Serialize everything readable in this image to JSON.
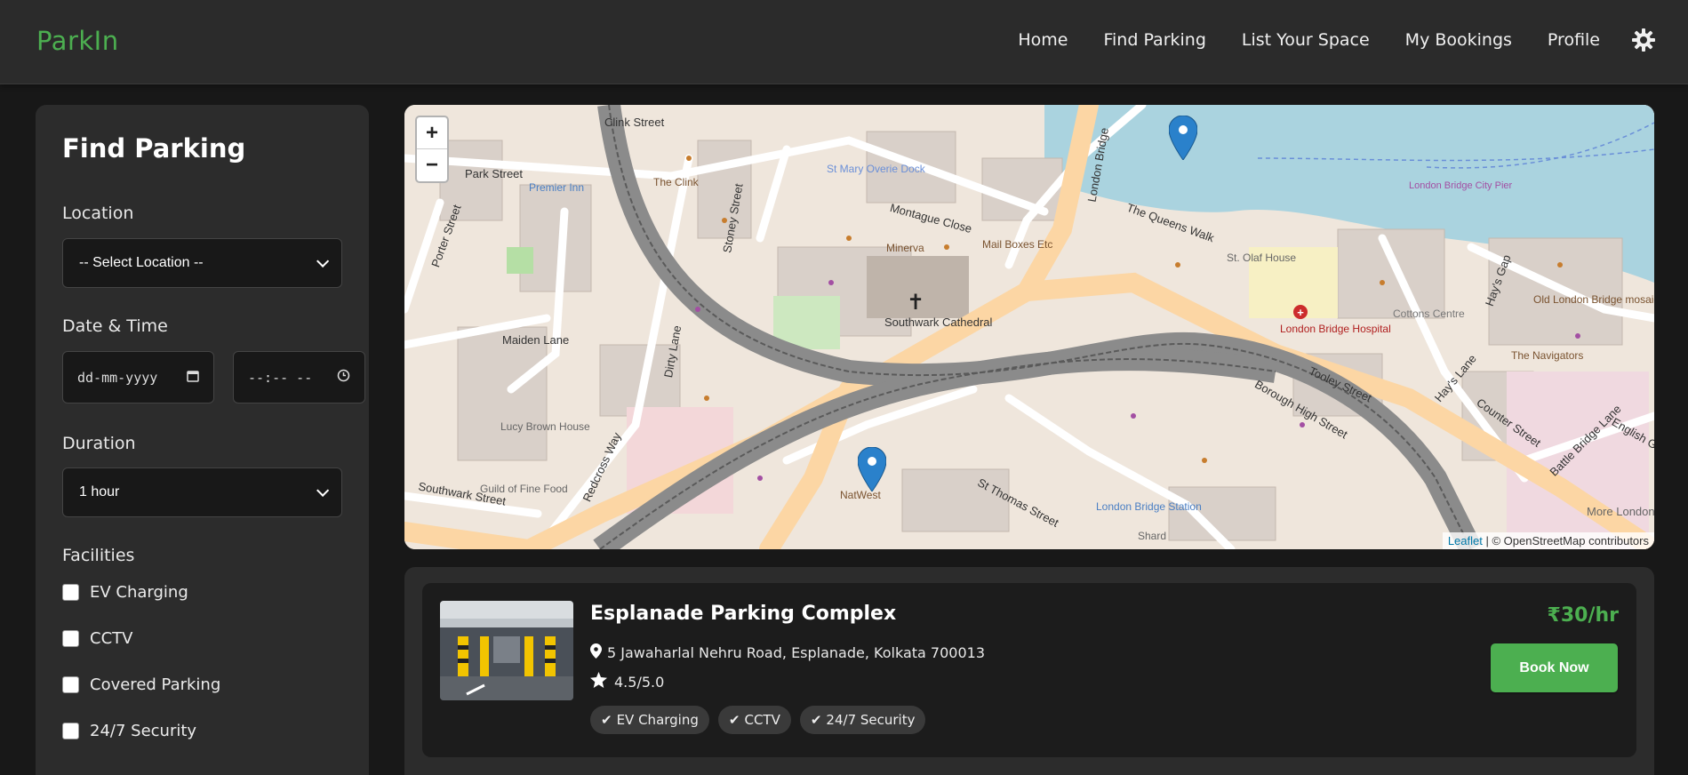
{
  "header": {
    "brand": "ParkIn",
    "nav": [
      "Home",
      "Find Parking",
      "List Your Space",
      "My Bookings",
      "Profile"
    ],
    "theme_icon": "gear-icon"
  },
  "sidebar": {
    "title": "Find Parking",
    "location_label": "Location",
    "location_value": "-- Select Location --",
    "datetime_label": "Date & Time",
    "date_placeholder": "dd-mm-yyyy",
    "time_placeholder": "--:-- --",
    "duration_label": "Duration",
    "duration_value": "1 hour",
    "facilities_label": "Facilities",
    "facilities": [
      "EV Charging",
      "CCTV",
      "Covered Parking",
      "24/7 Security"
    ]
  },
  "map": {
    "zoom_in": "+",
    "zoom_out": "−",
    "attribution_link": "Leaflet",
    "attribution_text": "| © OpenStreetMap contributors",
    "labels": [
      "Clink Street",
      "Park Street",
      "Premier Inn",
      "Porter Street",
      "The Clink",
      "Stoney Street",
      "St Mary Overie Dock",
      "Montague Close",
      "Minerva",
      "Mail Boxes Etc",
      "London Bridge",
      "The Queens Walk",
      "St. Olaf House",
      "Southwark Cathedral",
      "London Bridge Hospital",
      "Cottons Centre",
      "Hay's Gap",
      "Old London Bridge mosaic",
      "The Navigators",
      "Maiden Lane",
      "Dirty Lane",
      "Tooley Street",
      "Lucy Brown House",
      "Guild of Fine Food",
      "Redcross Way",
      "NatWest",
      "St Thomas Street",
      "London Bridge Station",
      "Shard",
      "Counter Street",
      "Battle Bridge Lane",
      "English Gro",
      "More London",
      "London Bridge City Pier",
      "Hay's Lane",
      "Borough High Street",
      "Southwark Street"
    ]
  },
  "results": [
    {
      "name": "Esplanade Parking Complex",
      "address": "5 Jawaharlal Nehru Road, Esplanade, Kolkata 700013",
      "rating": "4.5/5.0",
      "price": "₹30/hr",
      "tags": [
        "EV Charging",
        "CCTV",
        "24/7 Security"
      ],
      "book_label": "Book Now"
    }
  ],
  "colors": {
    "accent": "#4caf50",
    "background": "#181818",
    "panel": "#2c2c2c",
    "water": "#aad3df",
    "main_road": "#fcd6a4"
  }
}
